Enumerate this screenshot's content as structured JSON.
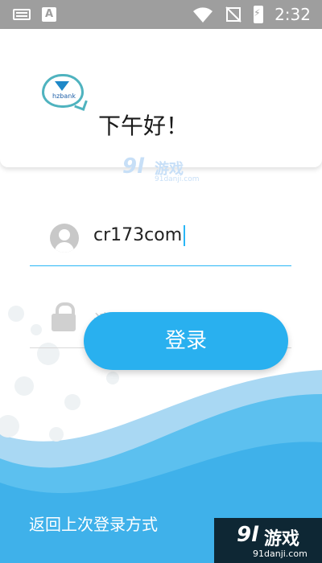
{
  "status_bar": {
    "time": "2:32",
    "notif_icon_letter": "A"
  },
  "header": {
    "greeting": "下午好！"
  },
  "logo": {
    "text": "hzbank"
  },
  "watermark": {
    "number": "9l",
    "title": "游戏",
    "url": "91danji.com"
  },
  "login": {
    "username_value": "cr173com",
    "password_placeholder": "请输入您的密码",
    "login_button": "登录",
    "back_link": "返回上次登录方式"
  },
  "colors": {
    "accent": "#29b0ef",
    "status_bar": "#9e9e9e"
  },
  "icons": [
    "keyboard-icon",
    "a-notification-icon",
    "wifi-icon",
    "no-signal-icon",
    "battery-charging-icon",
    "avatar-icon",
    "lock-icon"
  ]
}
